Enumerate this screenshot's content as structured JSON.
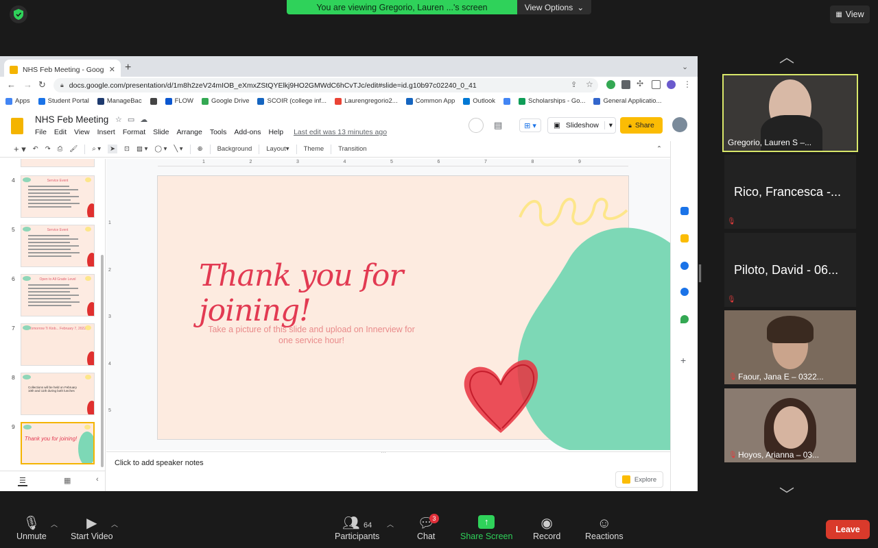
{
  "zoom": {
    "viewing_banner": "You are viewing Gregorio, Lauren ...'s screen",
    "view_options": "View Options",
    "view_button": "View",
    "participants_count": "64",
    "chat_badge": "3",
    "controls": {
      "unmute": "Unmute",
      "start_video": "Start Video",
      "participants": "Participants",
      "chat": "Chat",
      "share_screen": "Share Screen",
      "record": "Record",
      "reactions": "Reactions",
      "leave": "Leave"
    },
    "tiles": [
      {
        "name": "Gregorio, Lauren S –..."
      },
      {
        "name": "Rico, Francesca -..."
      },
      {
        "name": "Piloto, David - 06..."
      },
      {
        "name": "Faour, Jana E – 0322..."
      },
      {
        "name": "Hoyos, Arianna – 03..."
      }
    ]
  },
  "browser": {
    "tab_title": "NHS Feb Meeting - Google Slides",
    "url": "docs.google.com/presentation/d/1m8h2zeV24mIOB_eXmxZStQYElkj9HO2GMWdC6hCvTJc/edit#slide=id.g10b97c02240_0_41",
    "bookmarks": [
      "Apps",
      "Student Portal",
      "ManageBac",
      "",
      "FLOW",
      "Google Drive",
      "SCOIR (college inf...",
      "Laurengregorio2...",
      "Common App",
      "Outlook",
      "",
      "Scholarships - Go...",
      "General Applicatio..."
    ],
    "bookmark_colors": [
      "#4285f4",
      "#1a73e8",
      "#1e3a6e",
      "#444",
      "#0b57d0",
      "#34a853",
      "#1565c0",
      "#ea4335",
      "#1565c0",
      "#0078d4",
      "#4285f4",
      "#0f9d58",
      "#3366cc"
    ]
  },
  "slides": {
    "doc_title": "NHS Feb Meeting",
    "menu": [
      "File",
      "Edit",
      "View",
      "Insert",
      "Format",
      "Slide",
      "Arrange",
      "Tools",
      "Add-ons",
      "Help"
    ],
    "last_edit": "Last edit was 13 minutes ago",
    "slideshow": "Slideshow",
    "share": "Share",
    "toolbar": {
      "background": "Background",
      "layout": "Layout",
      "theme": "Theme",
      "transition": "Transition"
    },
    "thumbnails": [
      {
        "num": "4",
        "title": "Service Event"
      },
      {
        "num": "5",
        "title": "Service Event"
      },
      {
        "num": "6",
        "title": "Open to All Grade Level"
      },
      {
        "num": "7",
        "title": "Tomorrow Ti Kiob... February 7, 2022"
      },
      {
        "num": "8",
        "title": "Collections will be held on February 10th and 11th during both lunches"
      },
      {
        "num": "9",
        "title": "Thank you for joining!"
      }
    ],
    "ruler_marks": [
      "1",
      "2",
      "3",
      "4",
      "5",
      "6",
      "7",
      "8",
      "9"
    ],
    "ruler_v_marks": [
      "1",
      "2",
      "3",
      "4",
      "5"
    ],
    "slide": {
      "title": "Thank you for joining!",
      "subtitle": "Take a picture of this slide and upload on Innerview for one service hour!"
    },
    "speaker_notes_placeholder": "Click to add speaker notes",
    "explore": "Explore"
  },
  "colors": {
    "zoom_green": "#2fd25a",
    "slide_bg": "#fdebe0",
    "slide_title": "#e23a52",
    "blob_green": "#7dd8b6",
    "heart_red": "#e8323f",
    "share_yellow": "#fbbc04",
    "leave_red": "#d93a2b"
  }
}
